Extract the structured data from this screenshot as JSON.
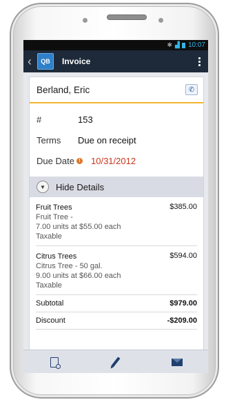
{
  "status_bar": {
    "time": "10:07"
  },
  "action_bar": {
    "logo_text": "QB",
    "title": "Invoice"
  },
  "customer": {
    "name": "Berland, Eric"
  },
  "invoice": {
    "number_label": "#",
    "number": "153",
    "terms_label": "Terms",
    "terms": "Due on receipt",
    "due_label": "Due Date",
    "due_date": "10/31/2012"
  },
  "details_toggle": {
    "label": "Hide Details"
  },
  "line_items": [
    {
      "name": "Fruit Trees",
      "amount": "$385.00",
      "description": "Fruit Tree -",
      "qty_line": "7.00 units at $55.00 each",
      "tax": "Taxable"
    },
    {
      "name": "Citrus Trees",
      "amount": "$594.00",
      "description": "Citrus Tree - 50 gal.",
      "qty_line": "9.00 units at $66.00 each",
      "tax": "Taxable"
    }
  ],
  "totals": {
    "subtotal_label": "Subtotal",
    "subtotal": "$979.00",
    "discount_label": "Discount",
    "discount": "-$209.00"
  },
  "colors": {
    "action_bar": "#1e2a3a",
    "accent_underline": "#f2b52d",
    "due_date": "#c9351e",
    "status_icons": "#33b5e5"
  },
  "icons": {
    "back": "back-chevron-icon",
    "overflow": "overflow-menu-icon",
    "call": "phone-icon",
    "warning": "warning-icon",
    "toggle": "chevron-down-icon",
    "preview": "document-preview-icon",
    "edit": "pencil-icon",
    "email": "envelope-icon"
  }
}
